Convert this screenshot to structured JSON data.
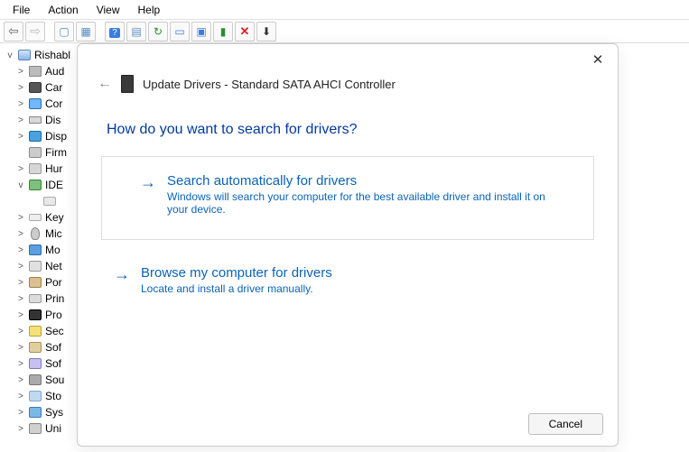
{
  "menubar": {
    "file": "File",
    "action": "Action",
    "view": "View",
    "help": "Help"
  },
  "toolbar_icons": {
    "back": "back",
    "forward": "forward",
    "up": "up",
    "grid": "grid",
    "help": "help",
    "cal": "calendar",
    "refresh": "refresh",
    "mon1": "monitor",
    "mon2": "monitor2",
    "dev": "device",
    "x": "delete",
    "down": "download"
  },
  "tree": {
    "root": "Rishabl",
    "items": [
      {
        "label": "Aud",
        "icon": "speaker",
        "expander": ">"
      },
      {
        "label": "Car",
        "icon": "cam",
        "expander": ">"
      },
      {
        "label": "Cor",
        "icon": "monitor",
        "expander": ">"
      },
      {
        "label": "Dis",
        "icon": "disk",
        "expander": ">"
      },
      {
        "label": "Disp",
        "icon": "dispadapt",
        "expander": ">"
      },
      {
        "label": "Firm",
        "icon": "chip",
        "expander": ""
      },
      {
        "label": "Hur",
        "icon": "usb",
        "expander": ">"
      },
      {
        "label": "IDE",
        "icon": "ide",
        "expander": "v"
      },
      {
        "label": "",
        "icon": "drive",
        "expander": "",
        "depth": 3
      },
      {
        "label": "Key",
        "icon": "kbd",
        "expander": ">"
      },
      {
        "label": "Mic",
        "icon": "mouse",
        "expander": ">"
      },
      {
        "label": "Mo",
        "icon": "screen",
        "expander": ">"
      },
      {
        "label": "Net",
        "icon": "net",
        "expander": ">"
      },
      {
        "label": "Por",
        "icon": "port",
        "expander": ">"
      },
      {
        "label": "Prin",
        "icon": "printer",
        "expander": ">"
      },
      {
        "label": "Pro",
        "icon": "proc",
        "expander": ">"
      },
      {
        "label": "Sec",
        "icon": "sec",
        "expander": ">"
      },
      {
        "label": "Sof",
        "icon": "soft",
        "expander": ">"
      },
      {
        "label": "Sof",
        "icon": "soft2",
        "expander": ">"
      },
      {
        "label": "Sou",
        "icon": "sound",
        "expander": ">"
      },
      {
        "label": "Sto",
        "icon": "storage",
        "expander": ">"
      },
      {
        "label": "Sys",
        "icon": "sys",
        "expander": ">"
      },
      {
        "label": "Uni",
        "icon": "usb2",
        "expander": ">"
      }
    ]
  },
  "dialog": {
    "title": "Update Drivers - Standard SATA AHCI Controller",
    "question": "How do you want to search for drivers?",
    "option1_title": "Search automatically for drivers",
    "option1_desc": "Windows will search your computer for the best available driver and install it on your device.",
    "option2_title": "Browse my computer for drivers",
    "option2_desc": "Locate and install a driver manually.",
    "cancel": "Cancel"
  }
}
